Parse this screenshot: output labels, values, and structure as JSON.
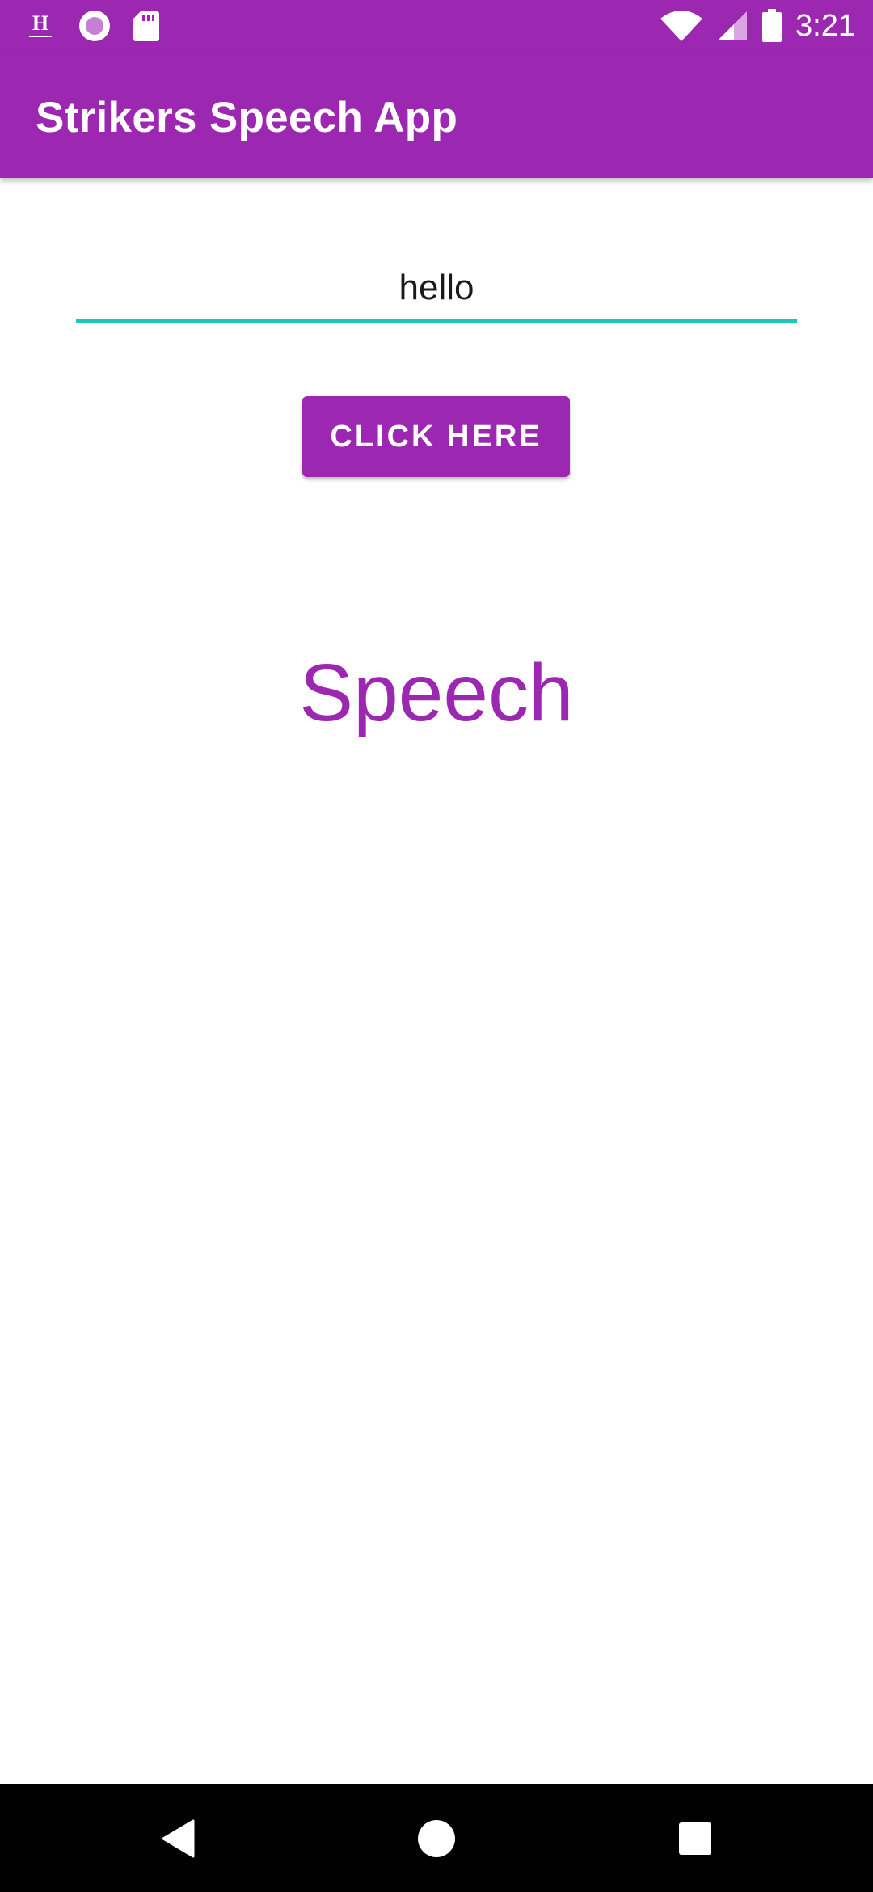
{
  "status_bar": {
    "time": "3:21",
    "left_icons": [
      "app-home-icon",
      "record-icon",
      "sd-card-icon"
    ],
    "right_icons": [
      "wifi-icon",
      "cellular-signal-icon",
      "battery-icon"
    ]
  },
  "app_bar": {
    "title": "Strikers Speech App"
  },
  "input": {
    "value": "hello"
  },
  "button": {
    "label": "CLICK HERE"
  },
  "output": {
    "text": "Speech"
  },
  "nav_bar": {
    "icons": [
      "back-icon",
      "home-icon",
      "recents-icon"
    ]
  },
  "colors": {
    "primary": "#9c27b0",
    "accent": "#1cc7b9",
    "nav_background": "#000000"
  }
}
